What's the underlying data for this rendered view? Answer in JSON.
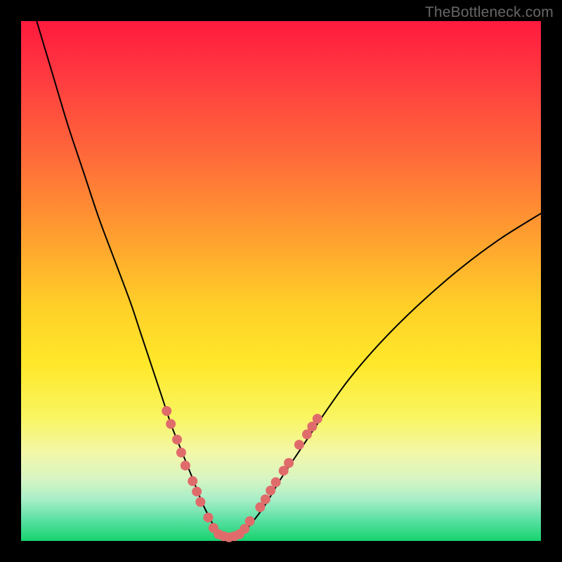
{
  "watermark": "TheBottleneck.com",
  "chart_data": {
    "type": "line",
    "title": "",
    "xlabel": "",
    "ylabel": "",
    "xlim": [
      0,
      100
    ],
    "ylim": [
      0,
      100
    ],
    "grid": false,
    "legend": false,
    "gradient_stops": [
      {
        "pct": 0,
        "color": "#ff1a3e"
      },
      {
        "pct": 10,
        "color": "#ff3840"
      },
      {
        "pct": 26,
        "color": "#ff6a3a"
      },
      {
        "pct": 40,
        "color": "#ff9a30"
      },
      {
        "pct": 55,
        "color": "#ffd028"
      },
      {
        "pct": 66,
        "color": "#ffe82a"
      },
      {
        "pct": 76,
        "color": "#f9f560"
      },
      {
        "pct": 83,
        "color": "#f3f7a8"
      },
      {
        "pct": 88,
        "color": "#d8f5c2"
      },
      {
        "pct": 92,
        "color": "#a8eec8"
      },
      {
        "pct": 96,
        "color": "#59e0a2"
      },
      {
        "pct": 100,
        "color": "#17d36d"
      }
    ],
    "series": [
      {
        "name": "left-branch",
        "stroke": "#000000",
        "x": [
          3,
          6,
          9,
          12,
          15,
          18,
          21,
          23,
          25,
          27,
          29,
          31,
          33,
          35,
          37,
          38
        ],
        "y": [
          100,
          90,
          80,
          71,
          62,
          54,
          46,
          40,
          34,
          28,
          22,
          17,
          12,
          7,
          3,
          1
        ]
      },
      {
        "name": "right-branch",
        "stroke": "#000000",
        "x": [
          42,
          44,
          47,
          50,
          54,
          58,
          63,
          69,
          76,
          84,
          92,
          100
        ],
        "y": [
          1,
          3,
          7,
          12,
          18,
          24,
          31,
          38,
          45,
          52,
          58,
          63
        ]
      },
      {
        "name": "valley-floor",
        "stroke": "#000000",
        "x": [
          38,
          39,
          40,
          41,
          42
        ],
        "y": [
          1,
          0.5,
          0.3,
          0.5,
          1
        ]
      }
    ],
    "markers": {
      "name": "highlight-dots",
      "color": "#e06b6b",
      "radius_px": 7,
      "points": [
        {
          "x": 28.0,
          "y": 25.0
        },
        {
          "x": 28.8,
          "y": 22.5
        },
        {
          "x": 30.0,
          "y": 19.5
        },
        {
          "x": 30.8,
          "y": 17.0
        },
        {
          "x": 31.6,
          "y": 14.5
        },
        {
          "x": 33.0,
          "y": 11.5
        },
        {
          "x": 33.8,
          "y": 9.5
        },
        {
          "x": 34.5,
          "y": 7.5
        },
        {
          "x": 36.0,
          "y": 4.5
        },
        {
          "x": 37.0,
          "y": 2.5
        },
        {
          "x": 38.0,
          "y": 1.3
        },
        {
          "x": 39.0,
          "y": 0.9
        },
        {
          "x": 40.0,
          "y": 0.7
        },
        {
          "x": 41.0,
          "y": 0.9
        },
        {
          "x": 42.0,
          "y": 1.3
        },
        {
          "x": 43.0,
          "y": 2.3
        },
        {
          "x": 44.0,
          "y": 3.8
        },
        {
          "x": 46.0,
          "y": 6.5
        },
        {
          "x": 47.0,
          "y": 8.0
        },
        {
          "x": 48.0,
          "y": 9.7
        },
        {
          "x": 49.0,
          "y": 11.3
        },
        {
          "x": 50.5,
          "y": 13.5
        },
        {
          "x": 51.5,
          "y": 15.0
        },
        {
          "x": 53.5,
          "y": 18.5
        },
        {
          "x": 55.0,
          "y": 20.5
        },
        {
          "x": 56.0,
          "y": 22.0
        },
        {
          "x": 57.0,
          "y": 23.5
        }
      ]
    }
  }
}
